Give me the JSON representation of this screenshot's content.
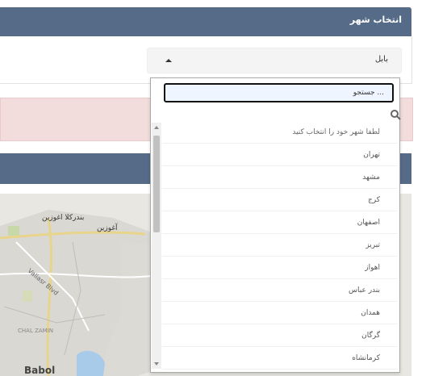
{
  "header": {
    "title": "انتخاب شهر"
  },
  "select": {
    "value": "بابل"
  },
  "search": {
    "placeholder": "جستجو ..."
  },
  "dropdown": {
    "items": [
      "لطفا شهر خود را انتخاب کنید",
      "تهران",
      "مشهد",
      "کرج",
      "اصفهان",
      "تبریز",
      "اهواز",
      "بندر عباس",
      "همدان",
      "گرگان",
      "کرمانشاه"
    ]
  },
  "map": {
    "labels": {
      "bandar": "بندرکلا اغوزین",
      "aghozin": "آغوزین",
      "blvd": "Valiasr Blvd",
      "chal": "CHAL ZAMIN",
      "babol": "Babol"
    }
  },
  "colors": {
    "header": "#566b87",
    "alert": "#f2dcdc",
    "focus": "#111111"
  }
}
